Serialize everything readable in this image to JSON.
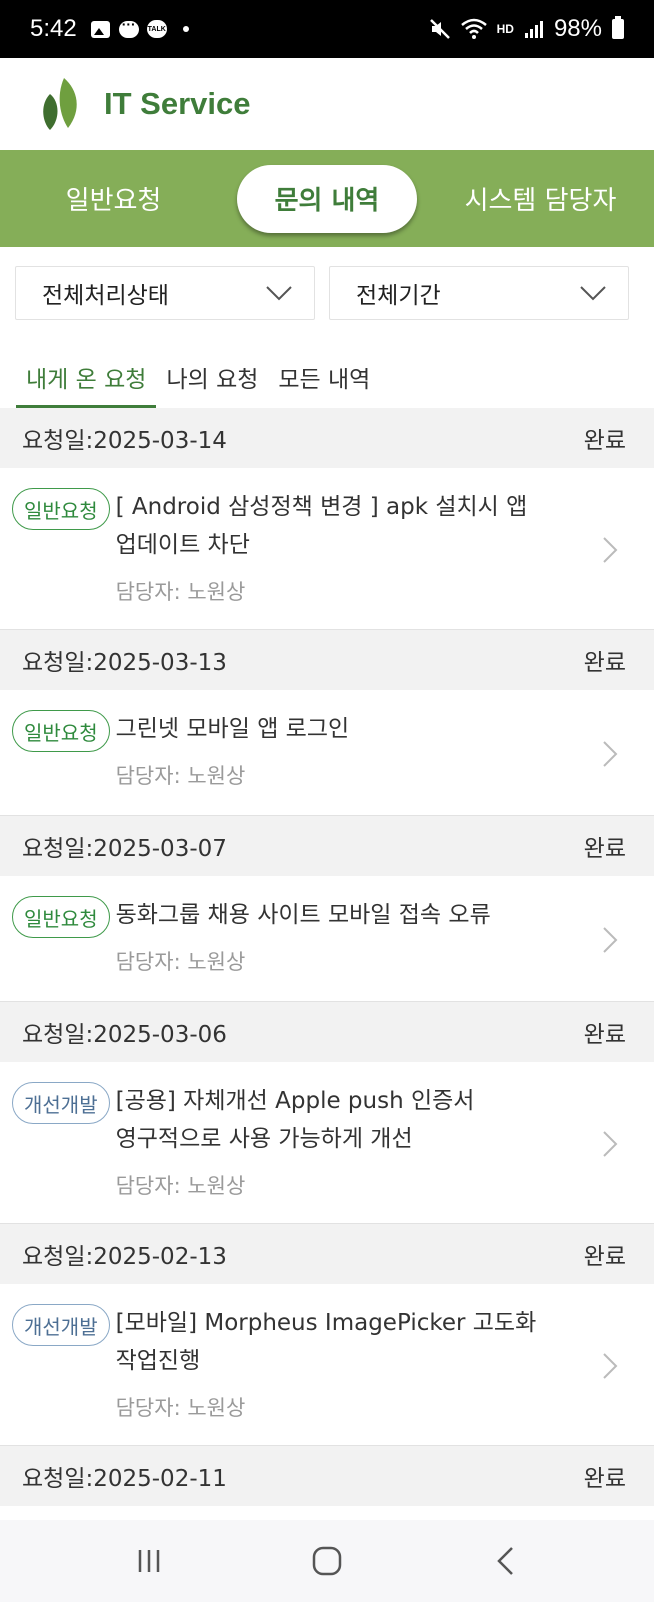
{
  "status_bar": {
    "time": "5:42",
    "talk_label": "TALK",
    "network": "HD",
    "battery": "98%"
  },
  "header": {
    "title": "IT Service"
  },
  "nav": {
    "tabs": [
      {
        "label": "일반요청"
      },
      {
        "label": "문의 내역"
      },
      {
        "label": "시스템 담당자"
      }
    ]
  },
  "filters": {
    "status": "전체처리상태",
    "period": "전체기간"
  },
  "subtabs": [
    {
      "label": "내게 온 요청"
    },
    {
      "label": "나의 요청"
    },
    {
      "label": "모든 내역"
    }
  ],
  "requests": [
    {
      "date": "요청일:2025-03-14",
      "status": "완료",
      "badge": "일반요청",
      "title_line1": "[ Android 삼성정책 변경 ] apk 설치시 앱",
      "title_line2": "업데이트 차단",
      "assignee": "담당자: 노원상"
    },
    {
      "date": "요청일:2025-03-13",
      "status": "완료",
      "badge": "일반요청",
      "title_line1": "그린넷 모바일 앱 로그인",
      "title_line2": "",
      "assignee": "담당자: 노원상"
    },
    {
      "date": "요청일:2025-03-07",
      "status": "완료",
      "badge": "일반요청",
      "title_line1": "동화그룹 채용 사이트 모바일 접속 오류",
      "title_line2": "",
      "assignee": "담당자: 노원상"
    },
    {
      "date": "요청일:2025-03-06",
      "status": "완료",
      "badge": "개선개발",
      "title_line1": "[공용] 자체개선 Apple push 인증서",
      "title_line2": "영구적으로 사용 가능하게 개선",
      "assignee": "담당자: 노원상"
    },
    {
      "date": "요청일:2025-02-13",
      "status": "완료",
      "badge": "개선개발",
      "title_line1": "[모바일] Morpheus ImagePicker 고도화",
      "title_line2": "작업진행",
      "assignee": "담당자: 노원상"
    },
    {
      "date": "요청일:2025-02-11",
      "status": "완료"
    }
  ],
  "colors": {
    "brand_green": "#85ae58",
    "dark_green": "#3f7d3a",
    "badge_blue": "#8aa8c6"
  }
}
